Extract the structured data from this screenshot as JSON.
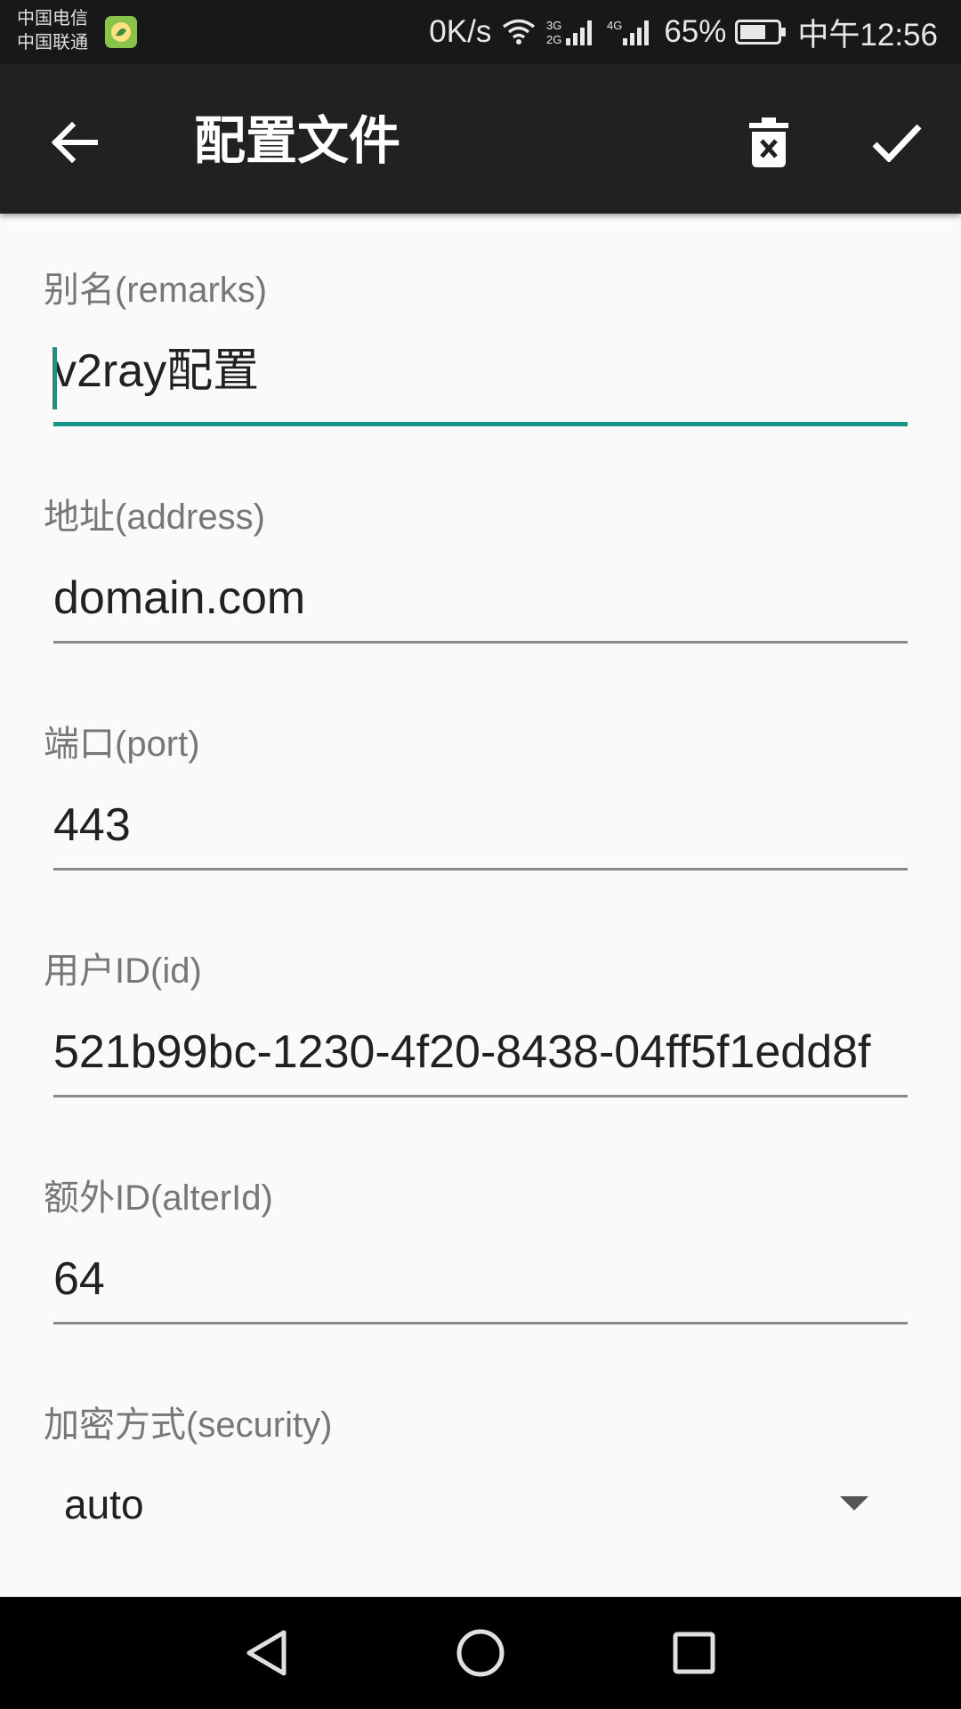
{
  "status_bar": {
    "carrier_primary": "中国电信",
    "carrier_secondary": "中国联通",
    "net_speed": "0K/s",
    "battery_percent": "65%",
    "time": "中午12:56",
    "icons": [
      "app-notification-icon",
      "wifi-icon",
      "signal-3g-2g-icon",
      "signal-4g-icon",
      "battery-icon"
    ]
  },
  "toolbar": {
    "title": "配置文件",
    "back_icon": "arrow-back-icon",
    "delete_icon": "delete-icon",
    "save_icon": "check-icon"
  },
  "form": {
    "remarks": {
      "label": "别名(remarks)",
      "value": "v2ray配置"
    },
    "address": {
      "label": "地址(address)",
      "value": "domain.com"
    },
    "port": {
      "label": "端口(port)",
      "value": "443"
    },
    "id": {
      "label": "用户ID(id)",
      "value": "521b99bc-1230-4f20-8438-04ff5f1edd8f"
    },
    "alter_id": {
      "label": "额外ID(alterId)",
      "value": "64"
    },
    "security": {
      "label": "加密方式(security)",
      "value": "auto",
      "icon": "dropdown-arrow-icon"
    }
  },
  "nav_bar": {
    "icons": [
      "nav-back-icon",
      "nav-home-icon",
      "nav-recents-icon"
    ]
  },
  "colors": {
    "accent": "#159688",
    "toolbar": "#212121",
    "background": "#fafafa",
    "label": "#777777"
  }
}
